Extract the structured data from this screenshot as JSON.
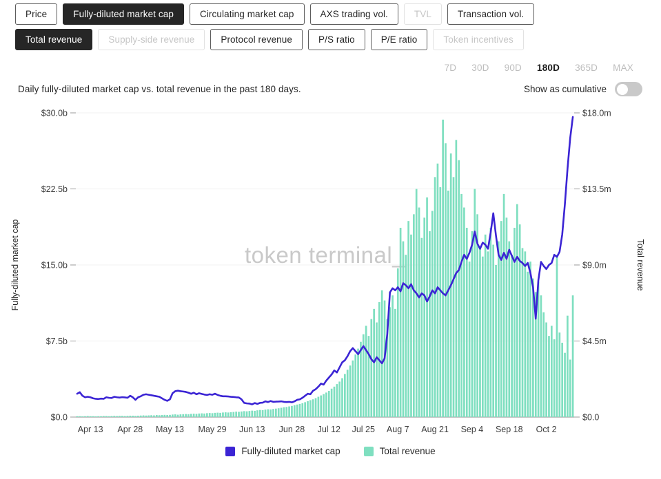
{
  "metric_tabs_row1": [
    {
      "label": "Price",
      "state": "normal"
    },
    {
      "label": "Fully-diluted market cap",
      "state": "active"
    },
    {
      "label": "Circulating market cap",
      "state": "normal"
    },
    {
      "label": "AXS trading vol.",
      "state": "normal"
    },
    {
      "label": "TVL",
      "state": "disabled"
    },
    {
      "label": "Transaction vol.",
      "state": "normal"
    }
  ],
  "metric_tabs_row2": [
    {
      "label": "Total revenue",
      "state": "active"
    },
    {
      "label": "Supply-side revenue",
      "state": "disabled"
    },
    {
      "label": "Protocol revenue",
      "state": "normal"
    },
    {
      "label": "P/S ratio",
      "state": "normal"
    },
    {
      "label": "P/E ratio",
      "state": "normal"
    },
    {
      "label": "Token incentives",
      "state": "disabled"
    }
  ],
  "range_selector": {
    "options": [
      "7D",
      "30D",
      "90D",
      "180D",
      "365D",
      "MAX"
    ],
    "selected": "180D"
  },
  "caption": "Daily fully-diluted market cap vs. total revenue in the past 180 days.",
  "cumulative_toggle": {
    "label": "Show as cumulative",
    "state": "off"
  },
  "watermark": "token terminal_",
  "legend": [
    {
      "label": "Fully-diluted market cap",
      "color": "#3b24d4"
    },
    {
      "label": "Total revenue",
      "color": "#7fdfc0"
    }
  ],
  "chart_data": {
    "type": "line",
    "title": "Daily fully-diluted market cap vs. total revenue in the past 180 days.",
    "xlabel": "",
    "ylabel": "Fully-diluted market cap",
    "y2label": "Total revenue",
    "grid": true,
    "legend_position": "bottom",
    "x_tick_labels": [
      "Apr 13",
      "Apr 28",
      "May 13",
      "May 29",
      "Jun 13",
      "Jun 28",
      "Jul 12",
      "Jul 25",
      "Aug 7",
      "Aug 21",
      "Sep 4",
      "Sep 18",
      "Oct 2"
    ],
    "x_tick_indices": [
      5,
      20,
      35,
      51,
      66,
      81,
      95,
      108,
      121,
      135,
      149,
      163,
      177
    ],
    "y_left": {
      "label": "Fully-diluted market cap",
      "ticks": [
        "$0.0",
        "$7.5b",
        "$15.0b",
        "$22.5b",
        "$30.0b"
      ],
      "tick_values": [
        0,
        7.5,
        15.0,
        22.5,
        30.0
      ],
      "min": 0,
      "max": 30.0,
      "unit": "b"
    },
    "y_right": {
      "label": "Total revenue",
      "ticks": [
        "$0.0",
        "$4.5m",
        "$9.0m",
        "$13.5m",
        "$18.0m"
      ],
      "tick_values": [
        0,
        4.5,
        9.0,
        13.5,
        18.0
      ],
      "min": 0,
      "max": 18.0,
      "unit": "m"
    },
    "series": [
      {
        "name": "Fully-diluted market cap",
        "type": "line",
        "color": "#3b24d4",
        "axis": "left",
        "unit": "b",
        "values": [
          2.3,
          2.45,
          2.1,
          1.95,
          2.0,
          1.95,
          1.85,
          1.8,
          1.78,
          1.82,
          1.8,
          1.95,
          1.9,
          1.88,
          2.0,
          1.95,
          1.92,
          1.96,
          1.94,
          1.9,
          2.1,
          1.95,
          1.7,
          1.95,
          2.05,
          2.2,
          2.25,
          2.2,
          2.15,
          2.1,
          2.05,
          2.0,
          1.85,
          1.7,
          1.6,
          1.75,
          2.35,
          2.55,
          2.6,
          2.55,
          2.52,
          2.48,
          2.4,
          2.3,
          2.4,
          2.25,
          2.35,
          2.28,
          2.22,
          2.18,
          2.25,
          2.2,
          2.3,
          2.18,
          2.1,
          2.05,
          2.05,
          2.03,
          2.0,
          1.98,
          1.95,
          1.93,
          1.75,
          1.4,
          1.35,
          1.33,
          1.25,
          1.38,
          1.3,
          1.4,
          1.42,
          1.55,
          1.48,
          1.58,
          1.5,
          1.52,
          1.53,
          1.55,
          1.5,
          1.48,
          1.5,
          1.45,
          1.55,
          1.7,
          1.75,
          1.9,
          2.1,
          2.3,
          2.25,
          2.6,
          2.75,
          3.0,
          3.3,
          3.2,
          3.6,
          3.9,
          4.2,
          4.6,
          4.4,
          4.9,
          5.4,
          5.6,
          6.0,
          6.5,
          6.8,
          6.5,
          6.2,
          6.6,
          7.0,
          6.6,
          6.2,
          5.7,
          5.4,
          5.9,
          5.6,
          5.3,
          5.8,
          8.2,
          12.3,
          12.7,
          12.5,
          12.8,
          12.4,
          13.2,
          13.0,
          12.7,
          13.1,
          12.5,
          12.2,
          11.8,
          12.2,
          12.0,
          11.4,
          11.9,
          12.5,
          12.2,
          12.8,
          12.5,
          12.2,
          12.0,
          12.5,
          13.0,
          13.6,
          14.2,
          14.5,
          15.3,
          16.0,
          15.6,
          16.2,
          17.0,
          18.3,
          17.1,
          16.6,
          17.2,
          17.0,
          16.6,
          18.2,
          20.1,
          17.9,
          16.0,
          15.5,
          16.2,
          15.6,
          16.5,
          15.9,
          15.3,
          15.8,
          15.4,
          15.2,
          14.9,
          15.2,
          14.2,
          12.8,
          9.7,
          13.5,
          15.3,
          14.9,
          14.6,
          15.0,
          15.2,
          16.0,
          15.8,
          16.3,
          18.0,
          21.0,
          24.5,
          27.5,
          29.6
        ]
      },
      {
        "name": "Total revenue",
        "type": "bar",
        "color": "#7fdfc0",
        "axis": "right",
        "unit": "m",
        "values": [
          0.05,
          0.05,
          0.04,
          0.05,
          0.06,
          0.05,
          0.05,
          0.04,
          0.05,
          0.05,
          0.06,
          0.06,
          0.05,
          0.06,
          0.07,
          0.06,
          0.07,
          0.07,
          0.06,
          0.07,
          0.08,
          0.08,
          0.07,
          0.08,
          0.09,
          0.1,
          0.09,
          0.1,
          0.11,
          0.1,
          0.12,
          0.11,
          0.12,
          0.13,
          0.12,
          0.13,
          0.15,
          0.16,
          0.14,
          0.16,
          0.17,
          0.18,
          0.17,
          0.19,
          0.2,
          0.19,
          0.21,
          0.22,
          0.21,
          0.23,
          0.24,
          0.23,
          0.25,
          0.26,
          0.25,
          0.27,
          0.28,
          0.27,
          0.29,
          0.3,
          0.32,
          0.31,
          0.33,
          0.35,
          0.34,
          0.36,
          0.38,
          0.37,
          0.4,
          0.42,
          0.41,
          0.44,
          0.46,
          0.45,
          0.48,
          0.5,
          0.52,
          0.55,
          0.58,
          0.6,
          0.63,
          0.66,
          0.7,
          0.74,
          0.78,
          0.82,
          0.88,
          0.94,
          1.0,
          1.05,
          1.12,
          1.2,
          1.28,
          1.36,
          1.45,
          1.55,
          1.68,
          1.8,
          1.95,
          2.1,
          2.3,
          2.55,
          2.8,
          3.05,
          3.35,
          3.7,
          4.05,
          4.45,
          4.9,
          5.4,
          4.8,
          5.8,
          6.4,
          5.6,
          6.8,
          7.5,
          6.9,
          5.8,
          6.5,
          7.2,
          6.4,
          8.8,
          11.2,
          10.4,
          9.6,
          11.6,
          10.8,
          12.0,
          13.5,
          12.4,
          10.6,
          11.8,
          13.0,
          11.0,
          12.2,
          14.2,
          15.0,
          13.6,
          17.6,
          16.2,
          13.4,
          15.6,
          14.2,
          16.4,
          15.2,
          13.2,
          12.4,
          11.2,
          9.2,
          11.0,
          13.5,
          12.0,
          10.0,
          9.5,
          10.8,
          9.8,
          11.2,
          10.2,
          9.0,
          10.4,
          11.6,
          13.2,
          11.8,
          10.4,
          9.6,
          11.2,
          12.6,
          11.4,
          10.0,
          9.8,
          8.6,
          9.2,
          8.2,
          7.4,
          8.0,
          7.2,
          6.2,
          5.6,
          4.8,
          5.4,
          4.6,
          9.6,
          5.0,
          4.4,
          3.8,
          6.0,
          3.4,
          7.2
        ]
      }
    ]
  }
}
